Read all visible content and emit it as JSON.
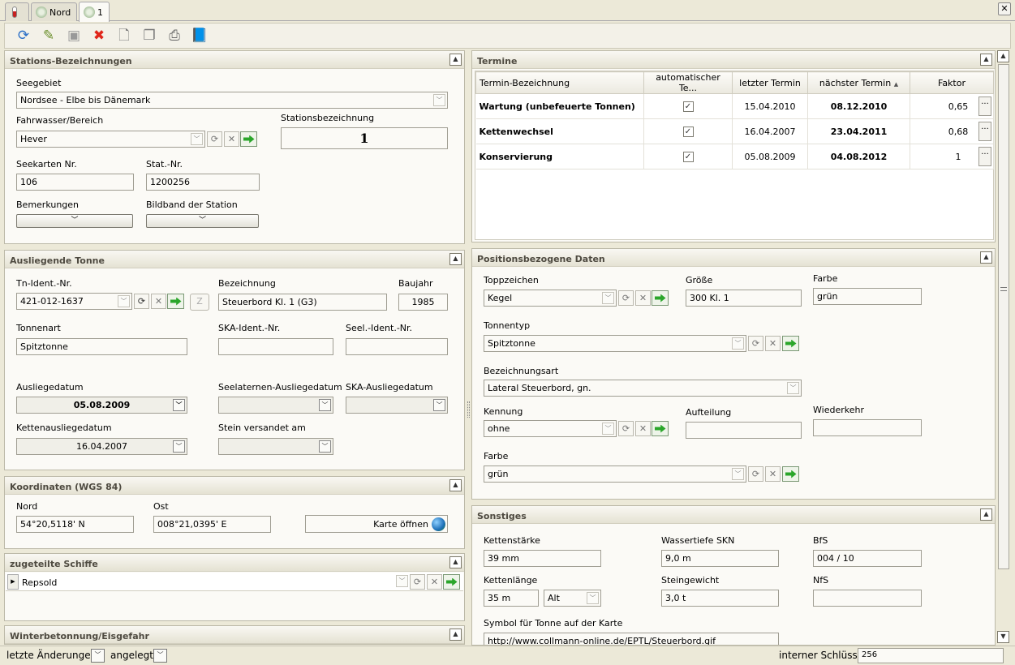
{
  "tabs": {
    "home": "",
    "nord": "Nord",
    "one": "1"
  },
  "stationen": {
    "header": "Stations-Bezeichnungen",
    "seegebiet_label": "Seegebiet",
    "seegebiet_value": "Nordsee - Elbe bis Dänemark",
    "fahrwasser_label": "Fahrwasser/Bereich",
    "fahrwasser_value": "Hever",
    "stationsbez_label": "Stationsbezeichnung",
    "stationsbez_value": "1",
    "seekarten_label": "Seekarten Nr.",
    "seekarten_value": "106",
    "statnr_label": "Stat.-Nr.",
    "statnr_value": "1200256",
    "bemerkungen_label": "Bemerkungen",
    "bildband_label": "Bildband der Station"
  },
  "tonne": {
    "header": "Ausliegende Tonne",
    "tnident_label": "Tn-Ident.-Nr.",
    "tnident_value": "421-012-1637",
    "z_label": "Z",
    "bezeichnung_label": "Bezeichnung",
    "bezeichnung_value": "Steuerbord Kl. 1 (G3)",
    "baujahr_label": "Baujahr",
    "baujahr_value": "1985",
    "tonnenart_label": "Tonnenart",
    "tonnenart_value": "Spitztonne",
    "ska_label": "SKA-Ident.-Nr.",
    "ska_value": "",
    "seel_label": "Seel.-Ident.-Nr.",
    "seel_value": "",
    "ausliege_label": "Ausliegedatum",
    "ausliege_value": "05.08.2009",
    "seelaternen_label": "Seelaternen-Ausliegedatum",
    "seelaternen_value": "",
    "skaausliege_label": "SKA-Ausliegedatum",
    "skaausliege_value": "",
    "ketten_label": "Kettenausliegedatum",
    "ketten_value": "16.04.2007",
    "stein_label": "Stein versandet am",
    "stein_value": ""
  },
  "koord": {
    "header": "Koordinaten (WGS 84)",
    "nord_label": "Nord",
    "nord_value": "54°20,5118' N",
    "ost_label": "Ost",
    "ost_value": "008°21,0395' E",
    "karte_label": "Karte öffnen"
  },
  "schiffe": {
    "header": "zugeteilte Schiffe",
    "row1": "Repsold"
  },
  "winter": {
    "header": "Winterbetonnung/Eisgefahr"
  },
  "termine": {
    "header": "Termine",
    "columns": [
      "Termin-Bezeichnung",
      "automatischer Te...",
      "letzter Termin",
      "nächster Termin",
      "Faktor"
    ],
    "sort_icon": "sort-ascending-icon",
    "rows": [
      {
        "name": "Wartung (unbefeuerte Tonnen)",
        "auto": "✓",
        "letzter": "15.04.2010",
        "naechster": "08.12.2010",
        "faktor": "0,65"
      },
      {
        "name": "Kettenwechsel",
        "auto": "✓",
        "letzter": "16.04.2007",
        "naechster": "23.04.2011",
        "faktor": "0,68"
      },
      {
        "name": "Konservierung",
        "auto": "✓",
        "letzter": "05.08.2009",
        "naechster": "04.08.2012",
        "faktor": "1"
      }
    ]
  },
  "position": {
    "header": "Positionsbezogene Daten",
    "topp_label": "Toppzeichen",
    "topp_value": "Kegel",
    "groesse_label": "Größe",
    "groesse_value": "300  Kl. 1",
    "farbe1_label": "Farbe",
    "farbe1_value": "grün",
    "tonnentyp_label": "Tonnentyp",
    "tonnentyp_value": "Spitztonne",
    "bezart_label": "Bezeichnungsart",
    "bezart_value": "Lateral Steuerbord, gn.",
    "kennung_label": "Kennung",
    "kennung_value": "ohne",
    "aufteilung_label": "Aufteilung",
    "aufteilung_value": "",
    "wiederkehr_label": "Wiederkehr",
    "wiederkehr_value": "",
    "farbe2_label": "Farbe",
    "farbe2_value": "grün"
  },
  "sonstiges": {
    "header": "Sonstiges",
    "kettenstaerke_label": "Kettenstärke",
    "kettenstaerke_value": "39 mm",
    "wassertiefe_label": "Wassertiefe SKN",
    "wassertiefe_value": "9,0 m",
    "bfs_label": "BfS",
    "bfs_value": "004 / 10",
    "kettenlaenge_label": "Kettenlänge",
    "kettenlaenge_value": "35 m",
    "alt_value": "Alt",
    "steingewicht_label": "Steingewicht",
    "steingewicht_value": "3,0 t",
    "nfs_label": "NfS",
    "nfs_value": "",
    "symbol_label": "Symbol für Tonne auf der Karte",
    "symbol_value": "http://www.collmann-online.de/EPTL/Steuerbord.gif"
  },
  "status": {
    "letzte": "letzte Änderungen",
    "angelegt": "angelegt",
    "schluessel_label": "interner Schlüssel",
    "schluessel_value": "256"
  }
}
